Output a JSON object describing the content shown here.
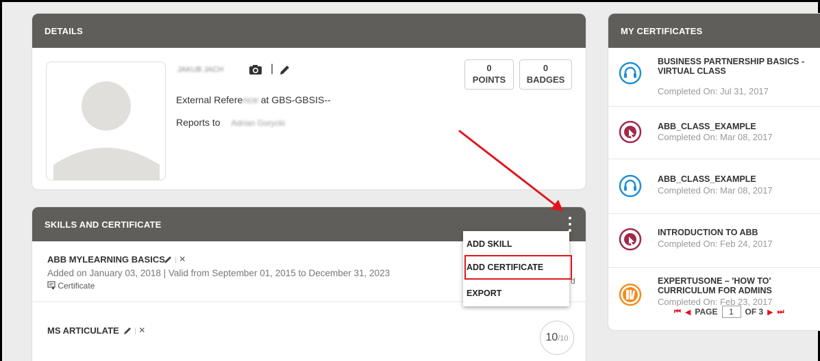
{
  "details": {
    "title": "DETAILS",
    "user_name": "JAKUB JACH",
    "external_ref_label": "External Refere",
    "external_ref_value": "at GBS-GBSIS--",
    "reports_to_label": "Reports to",
    "reports_to_value": "Adrian Gorycki",
    "points_value": "0",
    "points_label": "POINTS",
    "badges_value": "0",
    "badges_label": "BADGES"
  },
  "skills": {
    "title": "SKILLS AND CERTIFICATE",
    "items": [
      {
        "name": "ABB MYLEARNING BASICS",
        "meta": "Added on January 03, 2018 | Valid from September 01, 2015 to December 31, 2023",
        "type": "Certificate",
        "hidden_status": "d"
      },
      {
        "name": "MS ARTICULATE",
        "score_value": "10",
        "score_total": "/10"
      }
    ]
  },
  "menu": {
    "add_skill": "ADD SKILL",
    "add_certificate": "ADD CERTIFICATE",
    "export": "EXPORT"
  },
  "certificates": {
    "title": "MY CERTIFICATES",
    "items": [
      {
        "title": "BUSINESS PARTNERSHIP BASICS - VIRTUAL CLASS",
        "date": "Completed On: Jul 31, 2017",
        "icon": "headset-icon",
        "color": "#1e90d6"
      },
      {
        "title": "ABB_CLASS_EXAMPLE",
        "date": "Completed On: Mar 08, 2017",
        "icon": "globe-cursor-icon",
        "color": "#a0284a"
      },
      {
        "title": "ABB_CLASS_EXAMPLE",
        "date": "Completed On: Mar 08, 2017",
        "icon": "headset-icon",
        "color": "#1e90d6"
      },
      {
        "title": "INTRODUCTION TO ABB",
        "date": "Completed On: Feb 24, 2017",
        "icon": "globe-cursor-icon",
        "color": "#a0284a"
      },
      {
        "title": "EXPERTUSONE – 'HOW TO' CURRICULUM FOR ADMINS",
        "date": "Completed On: Feb 23, 2017",
        "icon": "books-icon",
        "color": "#f28c1e"
      }
    ],
    "pager": {
      "page_label": "PAGE",
      "current_page": "1",
      "of_label": "OF 3"
    }
  },
  "colors": {
    "header_bg": "#5f5e5a",
    "annotation_red": "#e0151b"
  }
}
